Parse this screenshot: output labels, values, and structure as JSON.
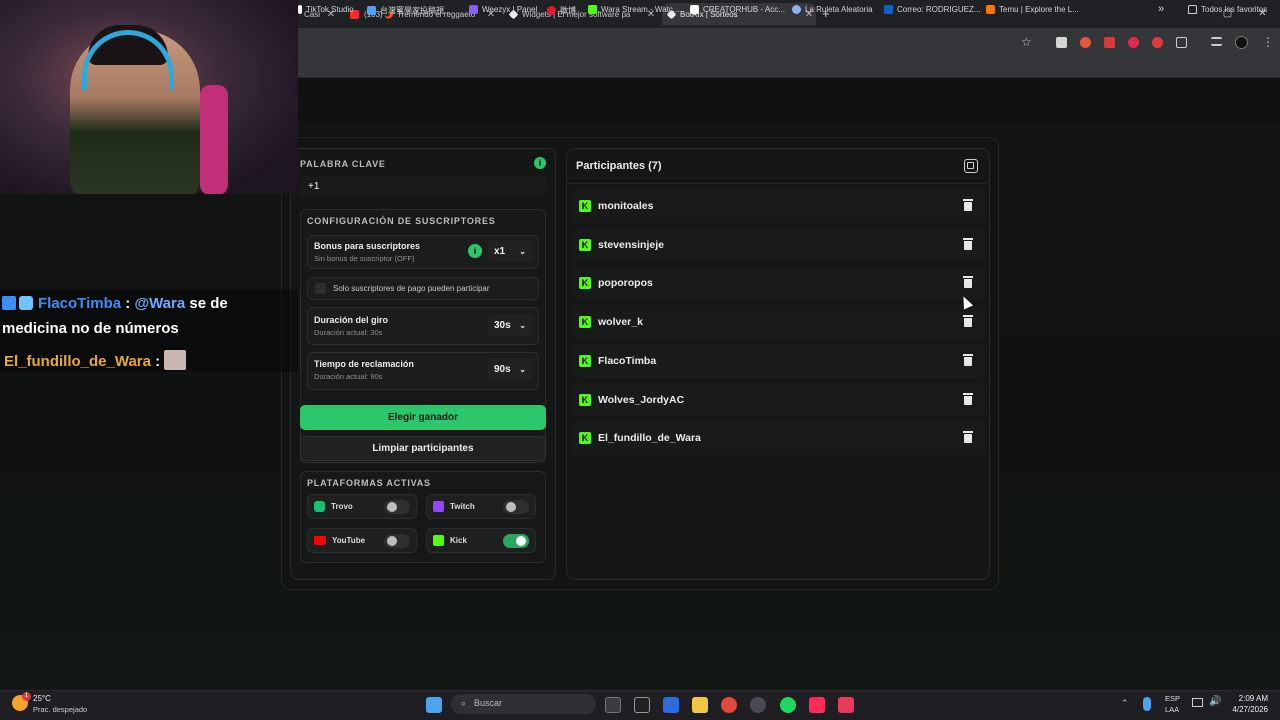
{
  "browser": {
    "tabs": [
      {
        "label": "Casi",
        "color": "#9aa0a6"
      },
      {
        "label": "(103) 🌶️ Tremendo el reggaeto",
        "color": "#ff2b2b"
      },
      {
        "label": "Widgets | El mejor software pa",
        "color": "#e8eaed"
      },
      {
        "label": "BotRix | Sorteos",
        "color": "#e8eaed"
      }
    ],
    "new_tab_icon": "+",
    "window_controls": [
      "—",
      "▢",
      "✕"
    ],
    "bookmarks": [
      {
        "label": "TikTok Studio",
        "color": "#ffffff"
      },
      {
        "label": "台灣蜜學家投稿視...",
        "color": "#4aa3ff"
      },
      {
        "label": "Weezyx | Panel",
        "color": "#8a5cff"
      },
      {
        "label": "微博",
        "color": "#e6162d"
      },
      {
        "label": "Wara Stream - Watc...",
        "color": "#53fc18"
      },
      {
        "label": "CREATORHUB - Acc...",
        "color": "#ffffff"
      },
      {
        "label": "La Ruleta Aleatoria",
        "color": "#8ab4f8"
      },
      {
        "label": "Correo: RODRIGUEZ...",
        "color": "#0a64c8"
      },
      {
        "label": "Temu | Explore the L...",
        "color": "#fb7701"
      }
    ],
    "bookmarks_more": "»",
    "all_bookmarks": "Todos los favoritos"
  },
  "stream_overlay": {
    "chat": [
      {
        "user": "FlacoTimba",
        "sep": ":",
        "mention": "@Wara",
        "text": "se de"
      },
      {
        "text": "medicina no de números"
      },
      {
        "user": "El_fundillo_de_Wara",
        "sep": ":"
      }
    ]
  },
  "left_panel": {
    "keyword_label": "PALABRA CLAVE",
    "keyword_value": "+1",
    "subs_section_title": "CONFIGURACIÓN DE SUSCRIPTORES",
    "bonus_title": "Bonus para suscriptores",
    "bonus_sub": "Sin bonus de suscriptor (OFF)",
    "bonus_value": "x1",
    "paid_only_label": "Solo suscriptores de pago pueden participar",
    "spin_title": "Duración del giro",
    "spin_sub": "Duración actual: 30s",
    "spin_value": "30s",
    "claim_title": "Tiempo de reclamación",
    "claim_sub": "Duración actual: 90s",
    "claim_value": "90s",
    "pick_winner": "Elegir ganador",
    "clear_participants": "Limpiar participantes",
    "platforms_title": "PLATAFORMAS ACTIVAS",
    "platforms": [
      {
        "name": "Trovo",
        "on": false,
        "color": "#1dbf73"
      },
      {
        "name": "Twitch",
        "on": false,
        "color": "#9146ff"
      },
      {
        "name": "YouTube",
        "on": false,
        "color": "#ff0000"
      },
      {
        "name": "Kick",
        "on": true,
        "color": "#53fc18"
      }
    ]
  },
  "right_panel": {
    "title": "Participantes (7)",
    "participants": [
      "monitoales",
      "stevensinjeje",
      "poporopos",
      "wolver_k",
      "FlacoTimba",
      "Wolves_JordyAC",
      "El_fundillo_de_Wara"
    ]
  },
  "taskbar": {
    "weather_temp": "25°C",
    "weather_desc": "Prac. despejado",
    "weather_badge": "1",
    "search_placeholder": "Buscar",
    "lang_top": "ESP",
    "lang_bottom": "LAA",
    "time": "2:09 AM",
    "date": "4/27/2026"
  },
  "colors": {
    "accent_green": "#2bc76a",
    "kick_green": "#53fc18",
    "chat_blue": "#3c8ef5",
    "chat_orange": "#e8a838"
  }
}
